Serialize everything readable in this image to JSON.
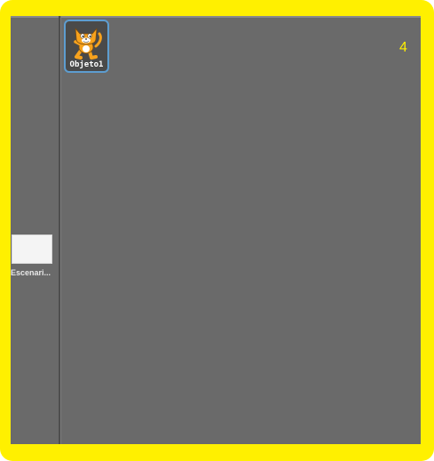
{
  "stage": {
    "label": "Escenari..."
  },
  "sprites": [
    {
      "label": "Objeto1",
      "icon": "scratch-cat-icon",
      "selected": true
    }
  ],
  "counter": "4",
  "colors": {
    "frame": "#fff000",
    "panel": "#6a6a6a",
    "selection_border": "#5d9dd0",
    "counter_text": "#fff000"
  }
}
